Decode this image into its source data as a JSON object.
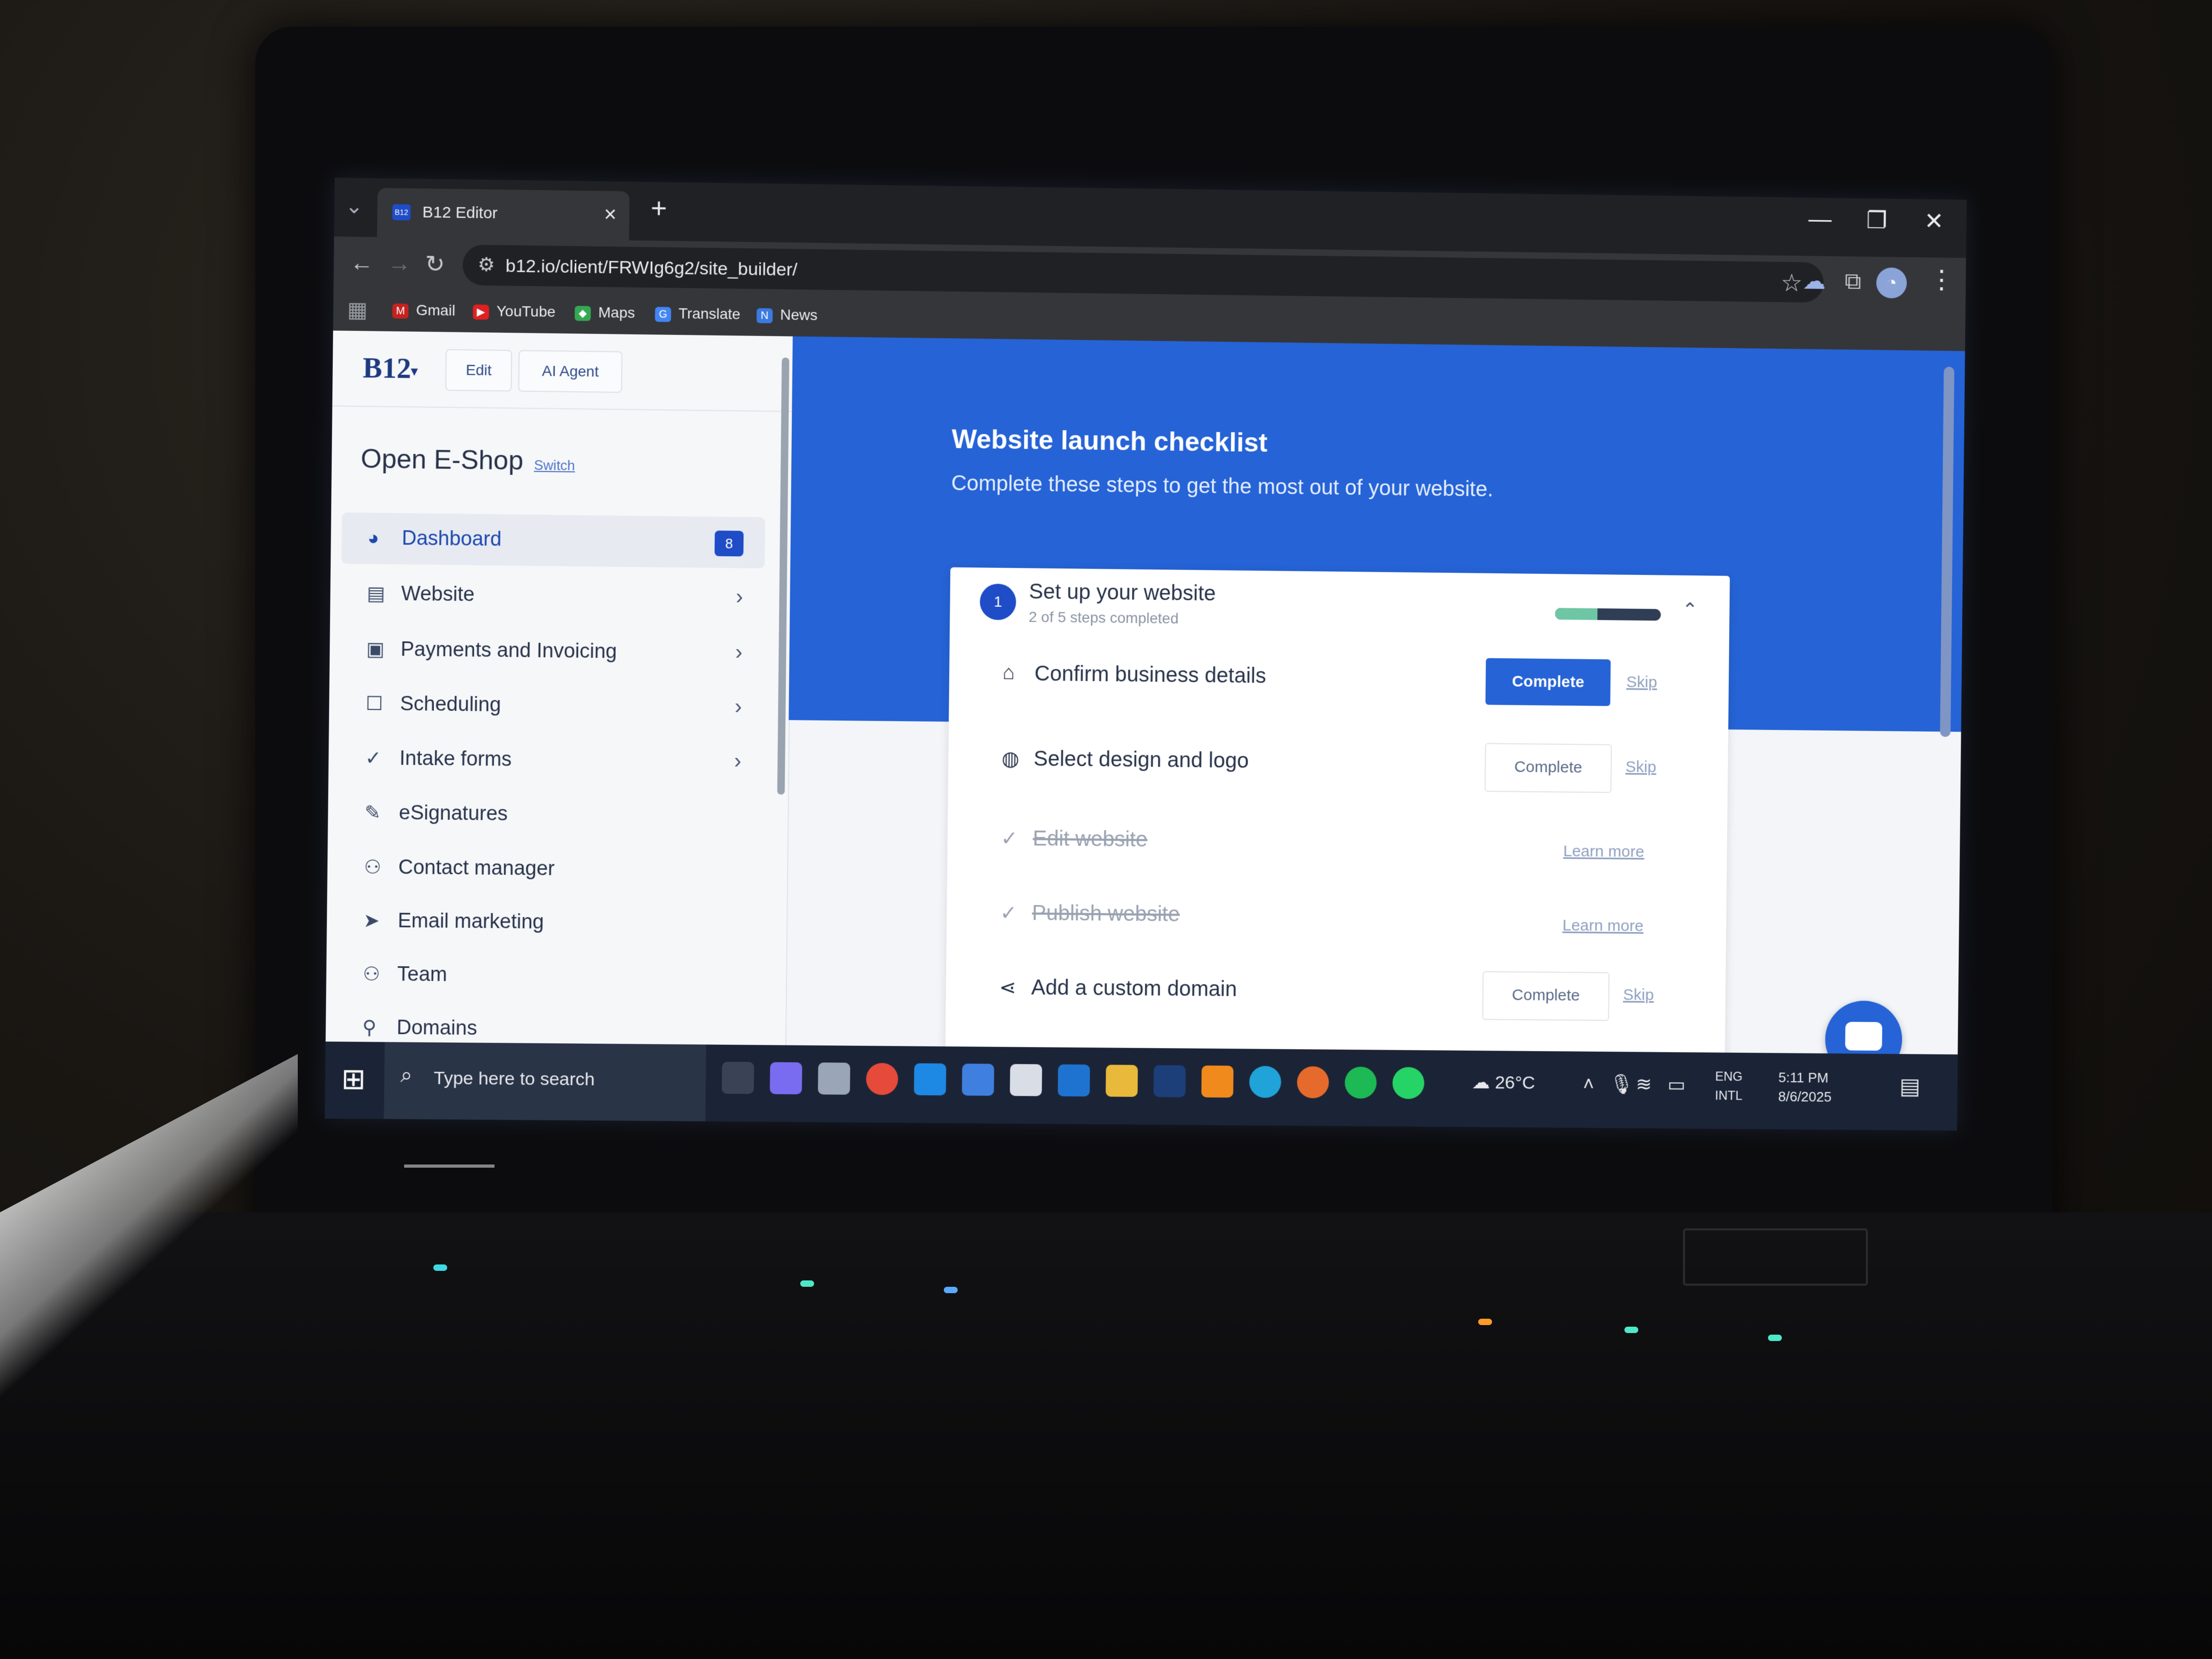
{
  "browser": {
    "tab_title": "B12 Editor",
    "tab_favicon": "B12",
    "url": "b12.io/client/FRWIg6g2/site_builder/",
    "bookmarks": [
      "Gmail",
      "YouTube",
      "Maps",
      "Translate",
      "News"
    ]
  },
  "app": {
    "logo": "B12",
    "edit_label": "Edit",
    "ai_agent_label": "AI Agent",
    "shop_name": "Open E-Shop",
    "switch_label": "Switch"
  },
  "sidebar": {
    "items": [
      {
        "label": "Dashboard",
        "icon": "dashboard-icon",
        "badge": "8"
      },
      {
        "label": "Website",
        "icon": "website-icon"
      },
      {
        "label": "Payments and Invoicing",
        "icon": "payments-icon"
      },
      {
        "label": "Scheduling",
        "icon": "calendar-icon"
      },
      {
        "label": "Intake forms",
        "icon": "check-circle-icon"
      },
      {
        "label": "eSignatures",
        "icon": "signature-icon"
      },
      {
        "label": "Contact manager",
        "icon": "contacts-icon"
      },
      {
        "label": "Email marketing",
        "icon": "send-icon"
      },
      {
        "label": "Team",
        "icon": "team-icon"
      },
      {
        "label": "Domains",
        "icon": "domains-icon"
      }
    ]
  },
  "checklist": {
    "title": "Website launch checklist",
    "subtitle": "Complete these steps to get the most out of your website.",
    "section": {
      "number": "1",
      "title": "Set up your website",
      "progress_text": "2 of 5 steps completed",
      "progress_fraction": 0.4
    },
    "rows": [
      {
        "label": "Confirm business details",
        "icon": "briefcase-icon",
        "action": "Complete",
        "skip": "Skip"
      },
      {
        "label": "Select design and logo",
        "icon": "palette-icon",
        "action": "Complete",
        "skip": "Skip"
      },
      {
        "label": "Edit website",
        "icon": "check-icon",
        "link": "Learn more"
      },
      {
        "label": "Publish website",
        "icon": "check-icon",
        "link": "Learn more"
      },
      {
        "label": "Add a custom domain",
        "icon": "share-icon",
        "action": "Complete",
        "skip": "Skip"
      }
    ]
  },
  "taskbar": {
    "search_placeholder": "Type here to search",
    "weather": "26°C",
    "language_1": "ENG",
    "language_2": "INTL",
    "time": "5:11 PM",
    "date": "8/6/2025"
  },
  "colors": {
    "accent": "#2563d6",
    "badge": "#1f4cc7",
    "progress_fill": "#6fc6a4"
  }
}
